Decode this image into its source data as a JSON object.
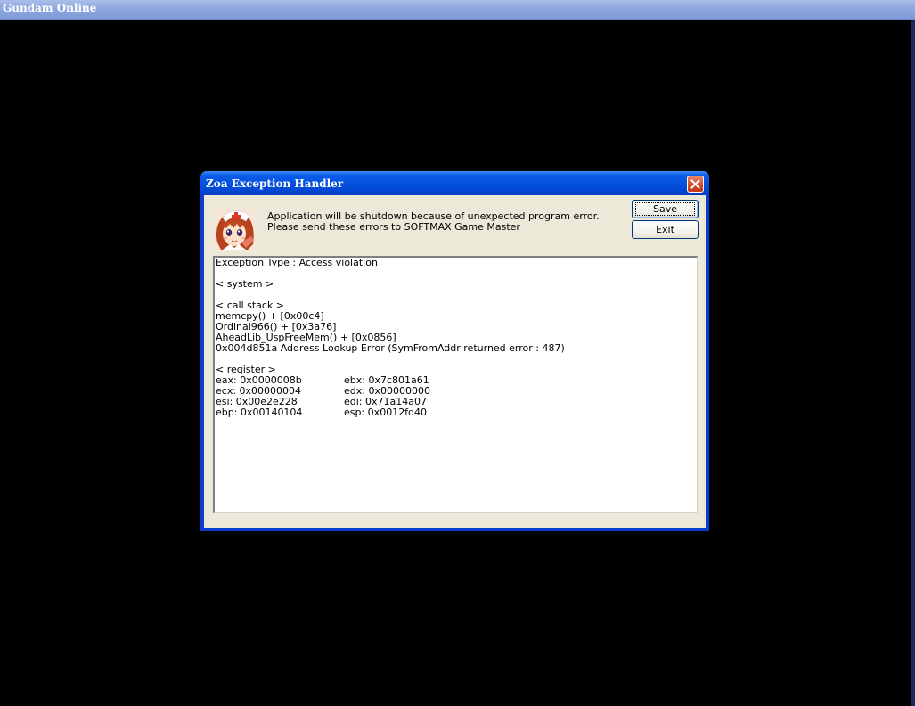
{
  "game_window": {
    "title": "Gundam Online"
  },
  "dialog": {
    "title": "Zoa Exception Handler",
    "message_lines": [
      "Application will be shutdown because of unexpected program error.",
      "Please send these errors to SOFTMAX Game Master"
    ],
    "save_label": "Save",
    "exit_label": "Exit",
    "log": {
      "lines_top": [
        "Exception Type : Access violation",
        "",
        "< system >",
        "",
        "< call stack >",
        "memcpy() + [0x00c4]",
        "Ordinal966() + [0x3a76]",
        "AheadLib_UspFreeMem() + [0x0856]",
        "0x004d851a Address Lookup Error (SymFromAddr returned error : 487)",
        "",
        "< register >"
      ],
      "registers": [
        {
          "left": "eax: 0x0000008b",
          "right": "ebx: 0x7c801a61"
        },
        {
          "left": "ecx: 0x00000004",
          "right": "edx: 0x00000000"
        },
        {
          "left": "esi: 0x00e2e228",
          "right": "edi: 0x71a14a07"
        },
        {
          "left": "ebp: 0x00140104",
          "right": "esp: 0x0012fd40"
        }
      ]
    }
  },
  "colors": {
    "title_bar_blue": "#0552de",
    "dialog_face": "#ece9d8",
    "close_red": "#d44a2a",
    "game_background": "#000000"
  },
  "icons": {
    "close": "close-icon",
    "avatar": "anime-character-avatar"
  }
}
